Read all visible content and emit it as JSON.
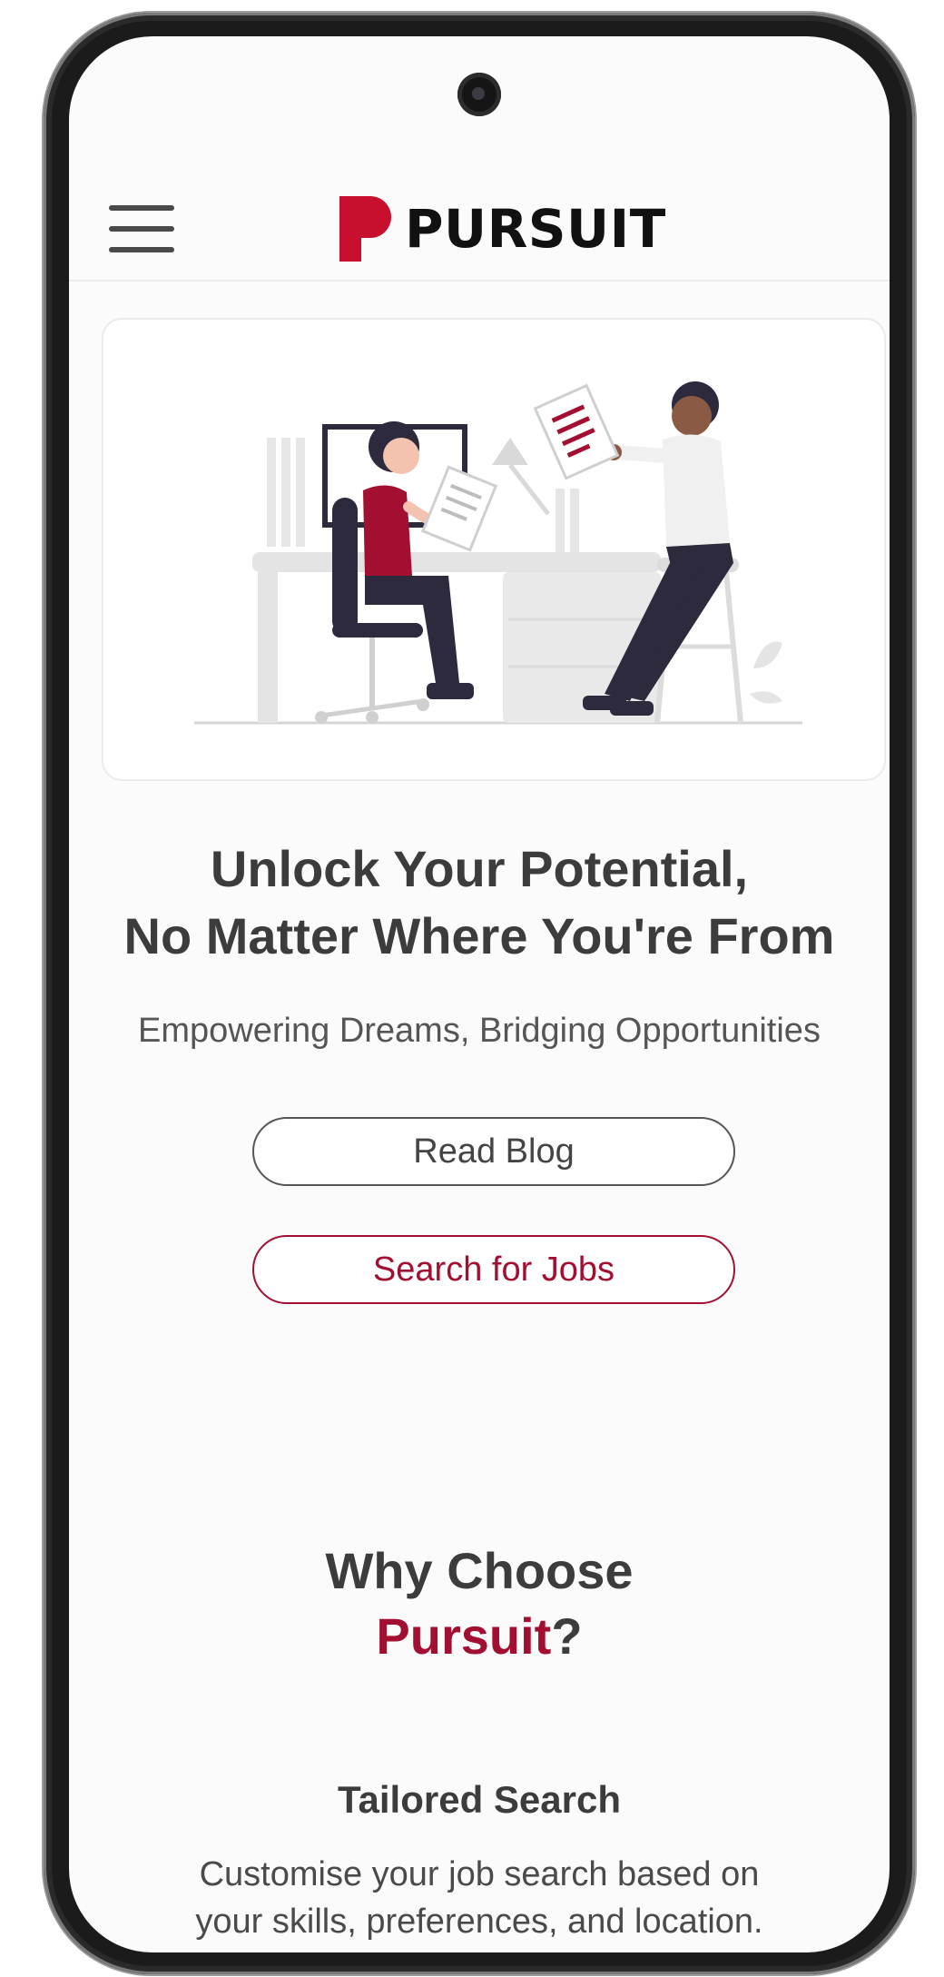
{
  "header": {
    "menu_icon": "hamburger-menu-icon",
    "logo_text": "PURSUIT"
  },
  "hero": {
    "illustration": "office-workers-illustration",
    "headline_line1": "Unlock Your Potential,",
    "headline_line2": "No Matter Where You're From",
    "subline": "Empowering Dreams, Bridging Opportunities",
    "read_blog_label": "Read Blog",
    "search_jobs_label": "Search for Jobs"
  },
  "why": {
    "title_line1": "Why Choose",
    "title_brand": "Pursuit",
    "title_suffix": "?"
  },
  "features": [
    {
      "title": "Tailored Search",
      "desc_line1": "Customise your job search based on",
      "desc_line2": "your skills, preferences, and location."
    }
  ],
  "colors": {
    "brand": "#a30f31",
    "text_dark": "#3c3c3c",
    "text_muted": "#555555"
  }
}
